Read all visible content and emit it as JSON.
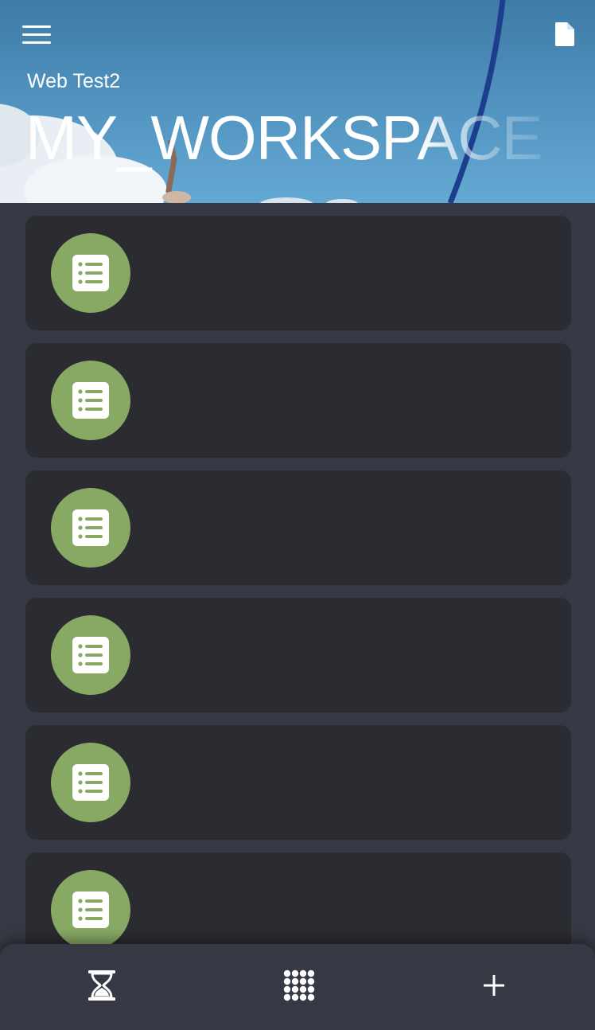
{
  "header": {
    "subtitle": "Web Test2",
    "title": "MY_WORKSPACE",
    "icons": {
      "menu": "hamburger-menu-icon",
      "document": "document-icon"
    }
  },
  "list": {
    "items": [
      {
        "icon": "list-icon",
        "title": ""
      },
      {
        "icon": "list-icon",
        "title": ""
      },
      {
        "icon": "list-icon",
        "title": ""
      },
      {
        "icon": "list-icon",
        "title": ""
      },
      {
        "icon": "list-icon",
        "title": ""
      },
      {
        "icon": "list-icon",
        "title": ""
      }
    ],
    "icon_bg_color": "#87a964",
    "card_color": "#2b2c31"
  },
  "bottom_nav": {
    "tabs": [
      {
        "icon": "hourglass-icon"
      },
      {
        "icon": "apps-grid-icon"
      },
      {
        "icon": "plus-icon"
      }
    ]
  },
  "colors": {
    "background": "#363843",
    "header_sky": "#4f90bd"
  }
}
